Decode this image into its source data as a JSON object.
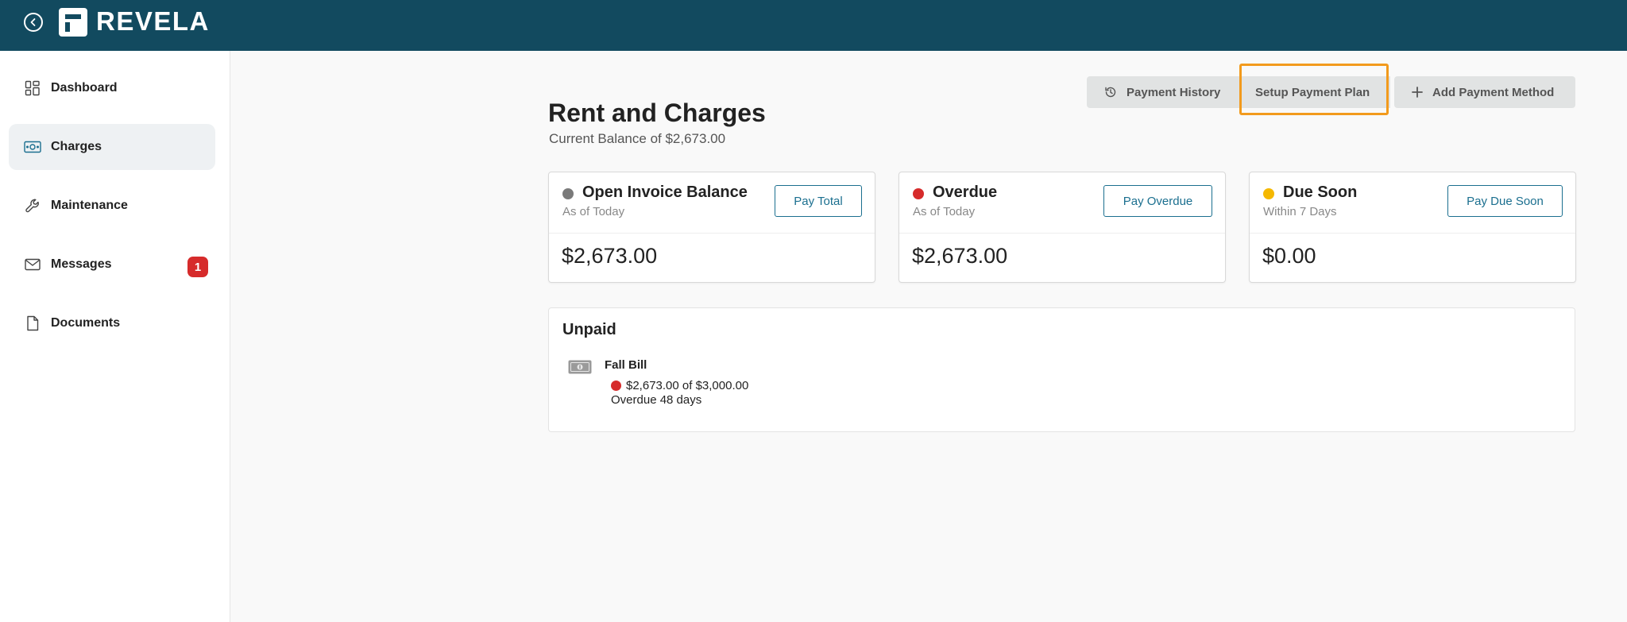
{
  "brand": {
    "name": "REVELA",
    "topbar_color": "#124a5f"
  },
  "sidebar": {
    "items": [
      {
        "label": "Dashboard",
        "icon": "dashboard-icon"
      },
      {
        "label": "Charges",
        "icon": "cash-icon",
        "active": true
      },
      {
        "label": "Maintenance",
        "icon": "wrench-icon"
      },
      {
        "label": "Messages",
        "icon": "envelope-icon",
        "badge": "1"
      },
      {
        "label": "Documents",
        "icon": "document-icon"
      }
    ]
  },
  "header": {
    "title": "Rent and Charges",
    "subtitle": "Current Balance of $2,673.00",
    "actions": {
      "history": "Payment History",
      "plan": "Setup Payment Plan",
      "method": "Add Payment Method"
    }
  },
  "cards": [
    {
      "title": "Open Invoice Balance",
      "subtitle": "As of Today",
      "button": "Pay Total",
      "amount": "$2,673.00",
      "dot_color": "#7a7a7a"
    },
    {
      "title": "Overdue",
      "subtitle": "As of Today",
      "button": "Pay Overdue",
      "amount": "$2,673.00",
      "dot_color": "#d62b2b"
    },
    {
      "title": "Due Soon",
      "subtitle": "Within 7 Days",
      "button": "Pay Due Soon",
      "amount": "$0.00",
      "dot_color": "#f5b800"
    }
  ],
  "unpaid": {
    "title": "Unpaid",
    "items": [
      {
        "name": "Fall Bill",
        "amount": "$2,673.00 of $3,000.00",
        "status": "Overdue 48 days",
        "icon": "money-bill-icon"
      }
    ]
  },
  "colors": {
    "accent": "#1b6f8f",
    "focus": "#f29a1d",
    "danger": "#d62b2b"
  }
}
